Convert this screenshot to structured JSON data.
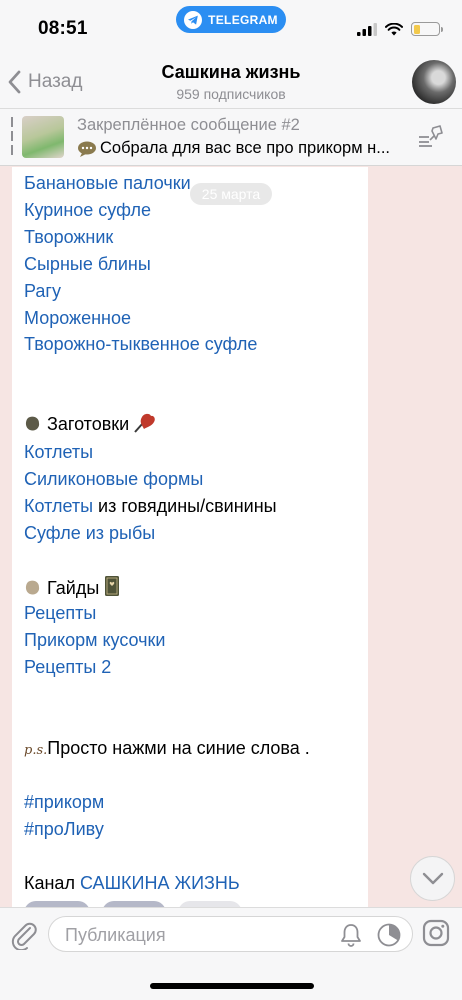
{
  "status_bar": {
    "time": "08:51",
    "app_pill": "TELEGRAM",
    "battery_level": 0.25
  },
  "header": {
    "back_label": "Назад",
    "title": "Сашкина жизнь",
    "subtitle": "959 подписчиков"
  },
  "pinned": {
    "title": "Закреплённое сообщение #2",
    "text": "Собрала для вас все про прикорм н..."
  },
  "date_pill": "25 марта",
  "message": {
    "recipes": [
      "Банановые палочки",
      "Куриное суфле",
      "Творожник",
      "Сырные блины",
      "Рагу",
      "Мороженное",
      "Творожно-тыквенное суфле"
    ],
    "section_preps": "Заготовки",
    "preps": {
      "item1": "Котлеты",
      "item2": "Силиконовые формы",
      "item3_link": "Котлеты",
      "item3_rest": " из говядины/свинины",
      "item4": "Суфле из рыбы"
    },
    "section_guides": "Гайды",
    "guides": [
      "Рецепты",
      "Прикорм кусочки",
      "Рецепты 2"
    ],
    "ps_mark": "p.s.",
    "ps_text": "Просто нажми на синие слова .",
    "hashtags": [
      "#прикорм",
      "#проЛиву"
    ],
    "channel_prefix": "Канал ",
    "channel_link": "САШКИНА ЖИЗНЬ"
  },
  "input": {
    "placeholder": "Публикация"
  },
  "colors": {
    "link": "#1f62b5",
    "telegram_blue": "#2b8ef2",
    "background": "#f6e5e3"
  },
  "icons": [
    "telegram-icon",
    "signal-icon",
    "wifi-icon",
    "battery-icon",
    "back-chevron-icon",
    "pin-list-icon",
    "speech-bubble-icon",
    "blob-icon",
    "heart-icon",
    "book-icon",
    "chevron-down-icon",
    "paperclip-icon",
    "bell-icon",
    "timer-icon",
    "instagram-icon"
  ]
}
